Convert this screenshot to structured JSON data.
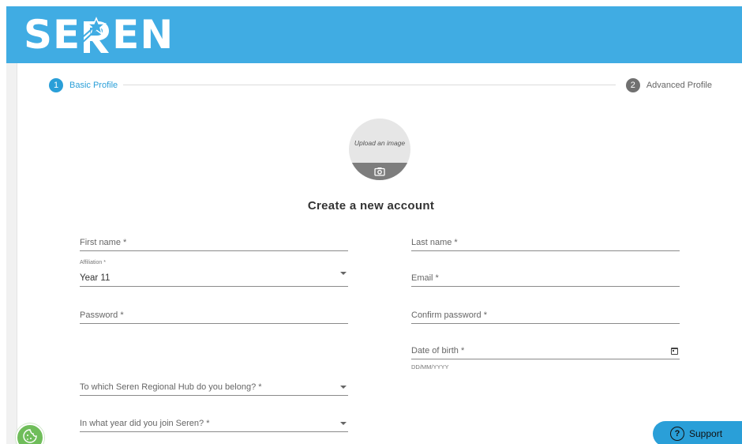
{
  "brand": {
    "logo_text_left": "SE",
    "logo_text_right": "EN"
  },
  "stepper": {
    "step1": {
      "number": "1",
      "label": "Basic Profile"
    },
    "step2": {
      "number": "2",
      "label": "Advanced Profile"
    }
  },
  "avatar": {
    "upload_text": "Upload an image"
  },
  "form": {
    "title": "Create a new account",
    "first_name": {
      "label": "First name *"
    },
    "last_name": {
      "label": "Last name *"
    },
    "affiliation": {
      "label": "Affiliation *",
      "value": "Year 11"
    },
    "email": {
      "label": "Email *"
    },
    "password": {
      "label": "Password *"
    },
    "confirm_password": {
      "label": "Confirm password *"
    },
    "dob": {
      "label": "Date of birth *",
      "helper": "DD/MM/YYYY"
    },
    "regional_hub": {
      "label": "To which Seren Regional Hub do you belong? *"
    },
    "join_year": {
      "label": "In what year did you join Seren? *"
    }
  },
  "support": {
    "label": "Support"
  },
  "colors": {
    "brand_blue": "#40ace3",
    "step_active": "#2a9fd8",
    "cookie_green": "#6fbd5a"
  }
}
